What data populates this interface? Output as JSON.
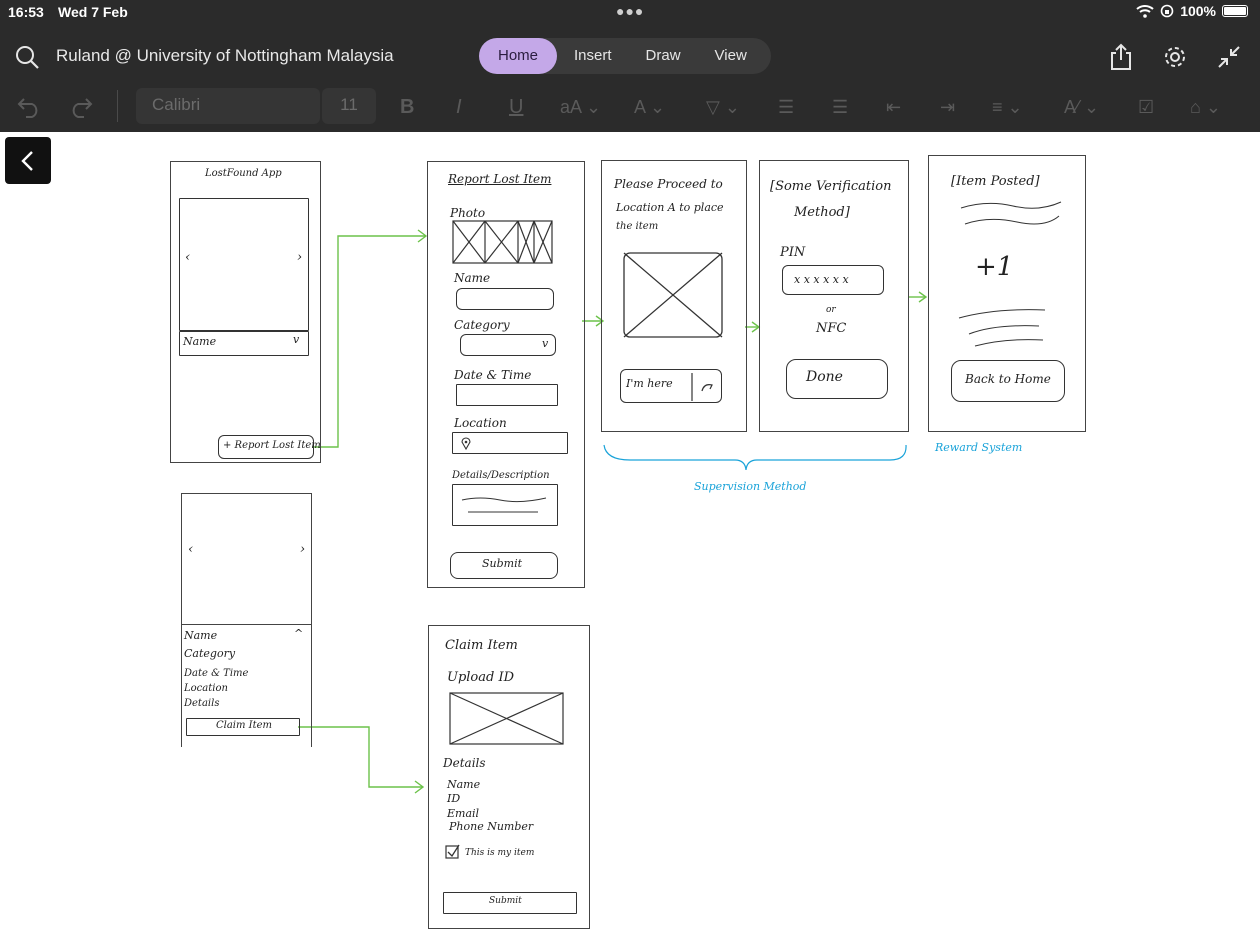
{
  "status": {
    "time": "16:53",
    "date": "Wed 7 Feb",
    "battery": "100%"
  },
  "notebook": {
    "title": "Ruland @ University of Nottingham Malaysia"
  },
  "tabs": [
    "Home",
    "Insert",
    "Draw",
    "View"
  ],
  "format_toolbar": {
    "font": "Calibri",
    "size": "11"
  },
  "sketch": {
    "home": {
      "title": "LostFound App",
      "dropdown": "Name",
      "report_button": "+ Report Lost Item"
    },
    "report": {
      "title": "Report Lost Item",
      "photo": "Photo",
      "name": "Name",
      "category": "Category",
      "datetime": "Date & Time",
      "location": "Location",
      "details": "Details/Description",
      "submit": "Submit"
    },
    "proceed": {
      "line1": "Please Proceed to",
      "line2": "Location A to place",
      "line3": "the item",
      "button": "I'm here"
    },
    "verify": {
      "line1": "[Some Verification",
      "line2": "Method]",
      "pin_label": "PIN",
      "pin_value": "x x x x x x",
      "or": "or",
      "nfc": "NFC",
      "done": "Done"
    },
    "posted": {
      "title": "[Item Posted]",
      "points": "+1",
      "back": "Back to Home"
    },
    "item_detail": {
      "fields": [
        "Name",
        "Category",
        "Date & Time",
        "Location",
        "Details"
      ],
      "claim": "Claim Item"
    },
    "claim": {
      "title": "Claim Item",
      "upload": "Upload ID",
      "details": "Details",
      "fields": [
        "Name",
        "ID",
        "Email",
        "Phone Number"
      ],
      "checkbox": "This is my item",
      "submit": "Submit"
    },
    "annotations": {
      "supervision": "Supervision Method",
      "reward": "Reward System"
    }
  },
  "colors": {
    "chrome_bg": "#2b2b2b",
    "tab_active": "#c4a8e8",
    "arrow_green": "#6cc24a",
    "annotation_blue": "#1aa3d9"
  }
}
